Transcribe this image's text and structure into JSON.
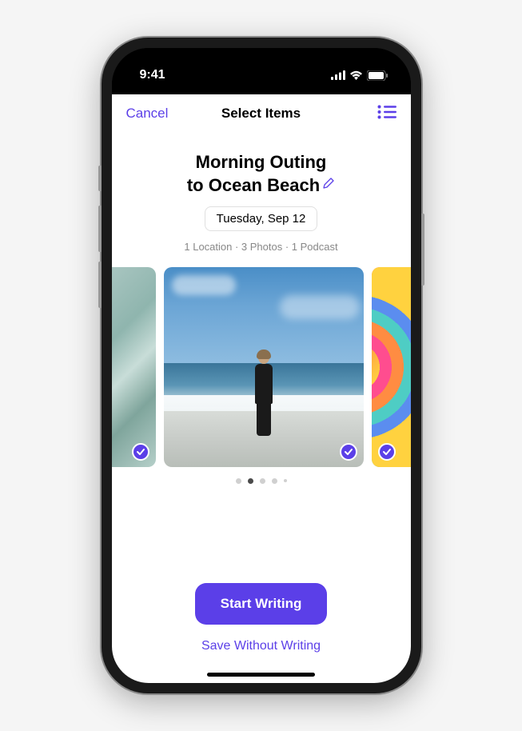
{
  "statusBar": {
    "time": "9:41"
  },
  "nav": {
    "cancel": "Cancel",
    "title": "Select Items"
  },
  "entry": {
    "title_line1": "Morning Outing",
    "title_line2": "to Ocean Beach",
    "date": "Tuesday, Sep 12",
    "summary": "1 Location · 3 Photos · 1 Podcast"
  },
  "carousel": {
    "activeIndex": 1,
    "totalDots": 5
  },
  "actions": {
    "primary": "Start Writing",
    "secondary": "Save Without Writing"
  },
  "colors": {
    "accent": "#5B3FE8"
  }
}
